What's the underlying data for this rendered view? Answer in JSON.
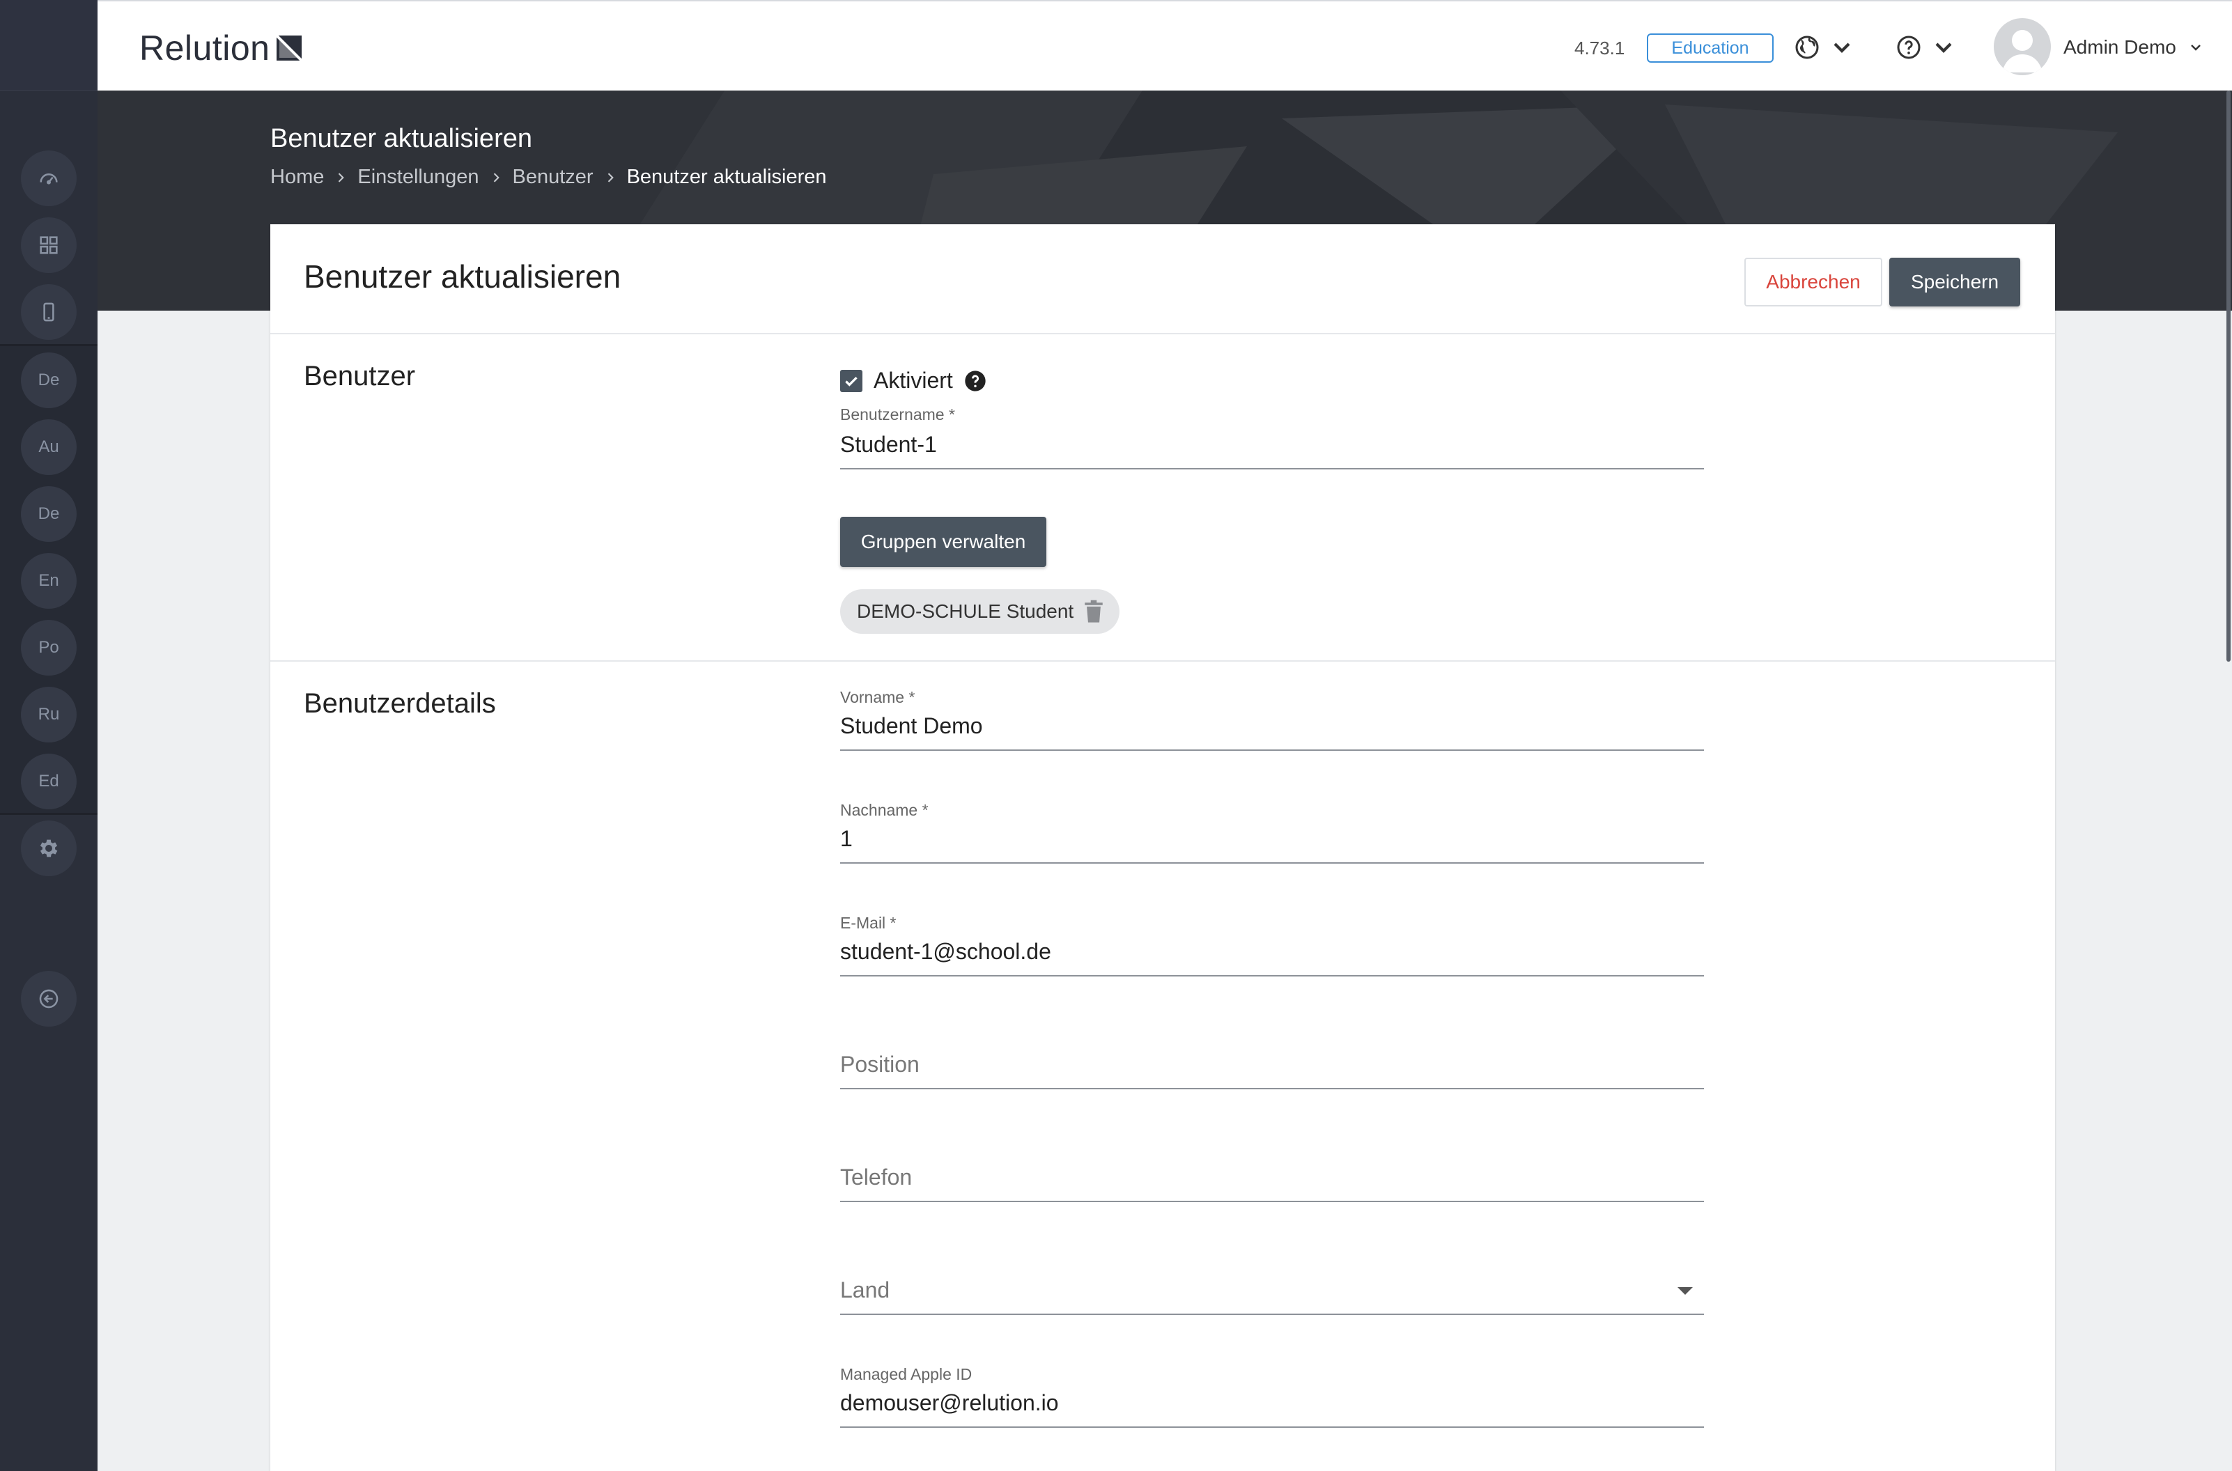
{
  "app": {
    "logo_text": "Relution",
    "version": "4.73.1",
    "edition": "Education",
    "user_name": "Admin Demo"
  },
  "sidebar": {
    "items": [
      {
        "label": "",
        "icon": "dashboard-icon"
      },
      {
        "label": "",
        "icon": "apps-grid-icon"
      },
      {
        "label": "",
        "icon": "device-icon"
      },
      {
        "label": "De",
        "icon": ""
      },
      {
        "label": "Au",
        "icon": ""
      },
      {
        "label": "De",
        "icon": ""
      },
      {
        "label": "En",
        "icon": ""
      },
      {
        "label": "Po",
        "icon": ""
      },
      {
        "label": "Ru",
        "icon": ""
      },
      {
        "label": "Ed",
        "icon": ""
      },
      {
        "label": "",
        "icon": "gear-icon"
      },
      {
        "label": "",
        "icon": "logout-icon"
      }
    ]
  },
  "hero": {
    "title": "Benutzer aktualisieren",
    "breadcrumb": [
      "Home",
      "Einstellungen",
      "Benutzer",
      "Benutzer aktualisieren"
    ]
  },
  "card": {
    "title": "Benutzer aktualisieren",
    "cancel_label": "Abbrechen",
    "save_label": "Speichern"
  },
  "user_section": {
    "title": "Benutzer",
    "activated_label": "Aktiviert",
    "activated": true,
    "username_label": "Benutzername *",
    "username_value": "Student-1",
    "manage_groups_label": "Gruppen verwalten",
    "groups": [
      "DEMO-SCHULE Student"
    ]
  },
  "details_section": {
    "title": "Benutzerdetails",
    "firstname_label": "Vorname *",
    "firstname_value": "Student Demo",
    "lastname_label": "Nachname *",
    "lastname_value": "1",
    "email_label": "E-Mail *",
    "email_value": "student-1@school.de",
    "position_placeholder": "Position",
    "phone_placeholder": "Telefon",
    "country_placeholder": "Land",
    "apple_id_label": "Managed Apple ID",
    "apple_id_value": "demouser@relution.io"
  },
  "colors": {
    "sidebar": "#2b2f3a",
    "primary_button": "#4a5560",
    "cancel_text": "#d9453c",
    "edition_badge": "#3a8fd9"
  }
}
